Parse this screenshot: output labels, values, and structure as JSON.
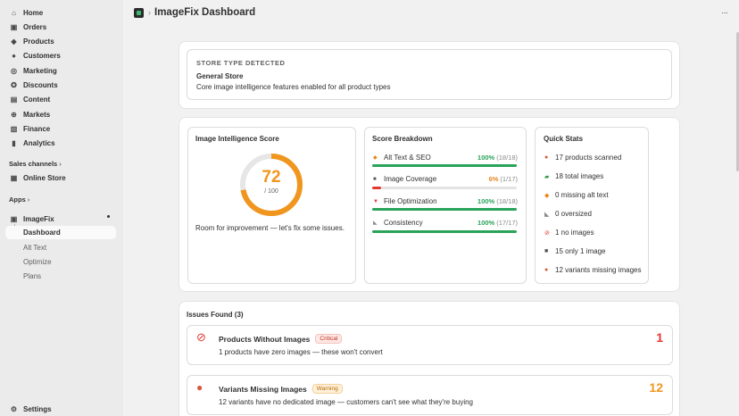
{
  "sidebar": {
    "nav": [
      {
        "label": "Home",
        "icon": "home-icon"
      },
      {
        "label": "Orders",
        "icon": "orders-icon"
      },
      {
        "label": "Products",
        "icon": "tag-icon"
      },
      {
        "label": "Customers",
        "icon": "person-icon"
      },
      {
        "label": "Marketing",
        "icon": "target-icon"
      },
      {
        "label": "Discounts",
        "icon": "discount-icon"
      },
      {
        "label": "Content",
        "icon": "content-icon"
      },
      {
        "label": "Markets",
        "icon": "globe-icon"
      },
      {
        "label": "Finance",
        "icon": "bank-icon"
      },
      {
        "label": "Analytics",
        "icon": "chart-icon"
      }
    ],
    "sales_channels_label": "Sales channels",
    "online_store": "Online Store",
    "apps_label": "Apps",
    "app_name": "ImageFix",
    "app_sub": [
      "Dashboard",
      "Alt Text",
      "Optimize",
      "Plans"
    ],
    "settings": "Settings"
  },
  "header": {
    "title": "ImageFix Dashboard",
    "more": "···",
    "chevron": "›"
  },
  "store": {
    "heading": "STORE TYPE DETECTED",
    "type": "General Store",
    "desc": "Core image intelligence features enabled for all product types"
  },
  "score": {
    "heading": "Image Intelligence Score",
    "value": "72",
    "max": "/ 100",
    "fraction": 0.72,
    "color": "#f0961e",
    "message": "Room for improvement — let's fix some issues."
  },
  "breakdown": {
    "heading": "Score Breakdown",
    "rows": [
      {
        "label": "Alt Text & SEO",
        "pct": "100%",
        "sub": "(18/18)",
        "fill": 1.0,
        "color": "#29a35a",
        "icon": "tag-icon"
      },
      {
        "label": "Image Coverage",
        "pct": "6%",
        "sub": "(1/17)",
        "fill": 0.06,
        "color": "#e5362f",
        "icon": "camera-icon"
      },
      {
        "label": "File Optimization",
        "pct": "100%",
        "sub": "(18/18)",
        "fill": 1.0,
        "color": "#29a35a",
        "icon": "bolt-icon"
      },
      {
        "label": "Consistency",
        "pct": "100%",
        "sub": "(17/17)",
        "fill": 1.0,
        "color": "#29a35a",
        "icon": "ruler-icon"
      }
    ]
  },
  "quick_stats": {
    "heading": "Quick Stats",
    "items": [
      {
        "text": "17 products scanned",
        "icon": "palette-icon"
      },
      {
        "text": "18 total images",
        "icon": "image-icon"
      },
      {
        "text": "0 missing alt text",
        "icon": "tag-icon"
      },
      {
        "text": "0 oversized",
        "icon": "ruler-icon"
      },
      {
        "text": "1 no images",
        "icon": "no-entry-icon"
      },
      {
        "text": "15 only 1 image",
        "icon": "camera-icon"
      },
      {
        "text": "12 variants missing images",
        "icon": "palette-icon"
      }
    ]
  },
  "issues": {
    "heading": "Issues Found (3)",
    "items": [
      {
        "title": "Products Without Images",
        "badge": "Critical",
        "desc": "1 products have zero images — these won't convert",
        "count": "1",
        "count_color": "#e5362f",
        "badge_bg": "#fde8e6",
        "badge_fg": "#c4301f",
        "icon": "no-entry-icon"
      },
      {
        "title": "Variants Missing Images",
        "badge": "Warning",
        "desc": "12 variants have no dedicated image — customers can't see what they're buying",
        "count": "12",
        "count_color": "#f0961e",
        "badge_bg": "#fff0d9",
        "badge_fg": "#b86a00",
        "icon": "palette-icon"
      }
    ]
  }
}
